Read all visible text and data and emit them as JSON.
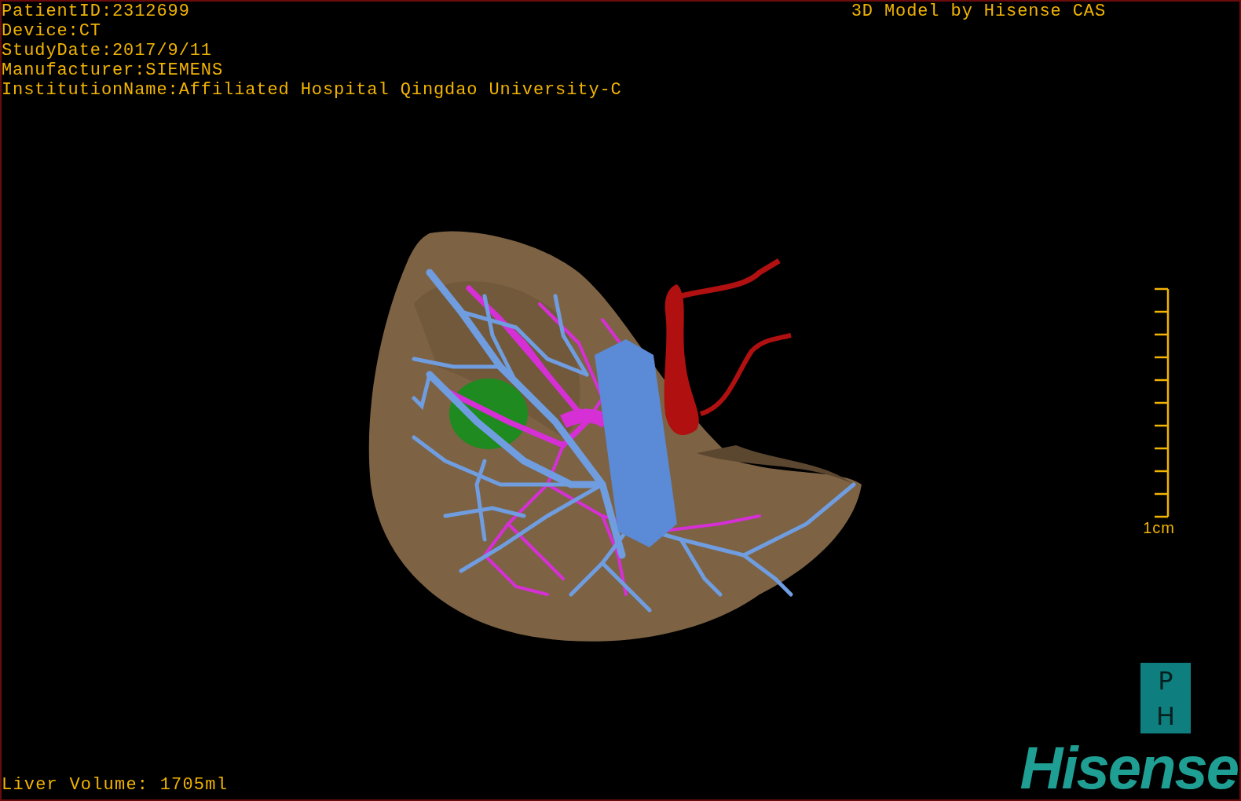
{
  "patient_info": [
    "PatientID:2312699",
    "Device:CT",
    "StudyDate:2017/9/11",
    "Manufacturer:SIEMENS",
    "InstitutionName:Affiliated Hospital Qingdao University-C"
  ],
  "title": "3D Model by Hisense CAS",
  "scale": {
    "label": "1cm"
  },
  "volume": "Liver Volume: 1705ml",
  "logo": {
    "badge_letters": [
      "P",
      "H"
    ],
    "wordmark": "Hisense"
  }
}
